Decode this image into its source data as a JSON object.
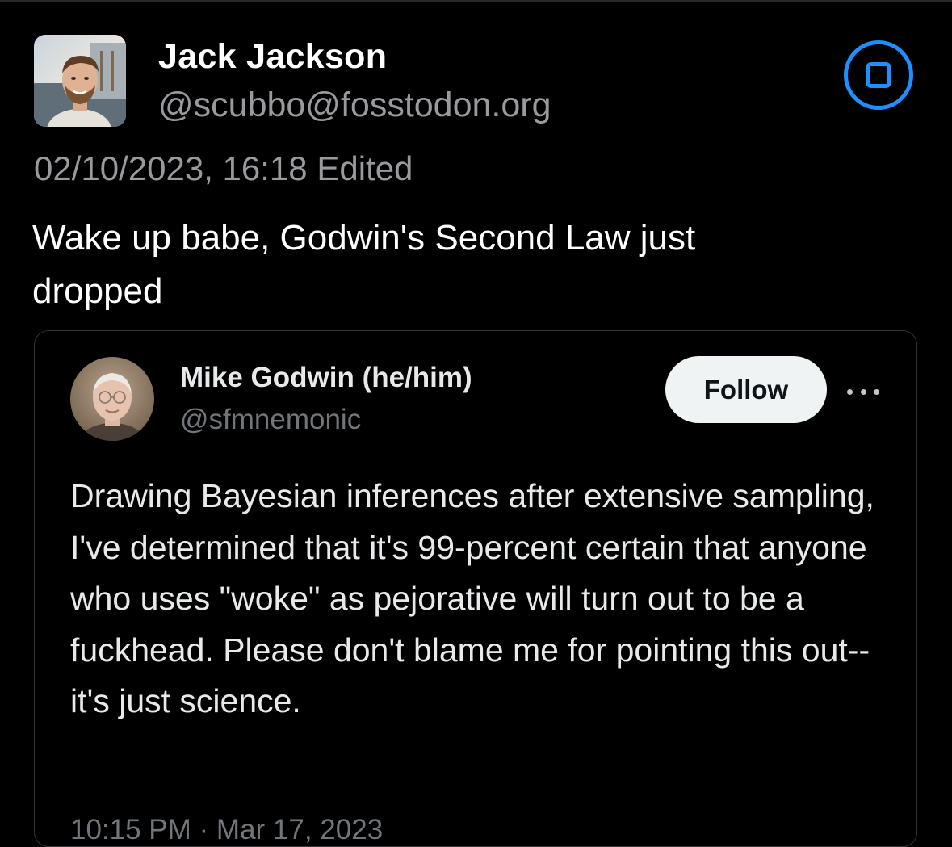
{
  "post": {
    "author": {
      "display_name": "Jack Jackson",
      "handle": "@scubbo@fosstodon.org",
      "avatar_icon": "profile-photo-man-beard"
    },
    "timestamp": "02/10/2023, 16:18",
    "edited_label": "Edited",
    "text": "Wake up babe, Godwin's Second Law just dropped",
    "options_icon": "square-in-circle-icon",
    "accent_color": "#1d8fff"
  },
  "embed": {
    "author": {
      "display_name": "Mike Godwin (he/him)",
      "handle": "@sfmnemonic",
      "avatar_icon": "profile-photo-older-man-glasses"
    },
    "follow_label": "Follow",
    "more_icon": "ellipsis-icon",
    "text": "Drawing Bayesian inferences after extensive sampling, I've determined that it's 99-percent certain that anyone who uses \"woke\" as pejorative will turn out to be a fuckhead. Please don't blame me for pointing this out--it's just science.",
    "footer_partial": "10:15 PM · Mar 17, 2023"
  }
}
